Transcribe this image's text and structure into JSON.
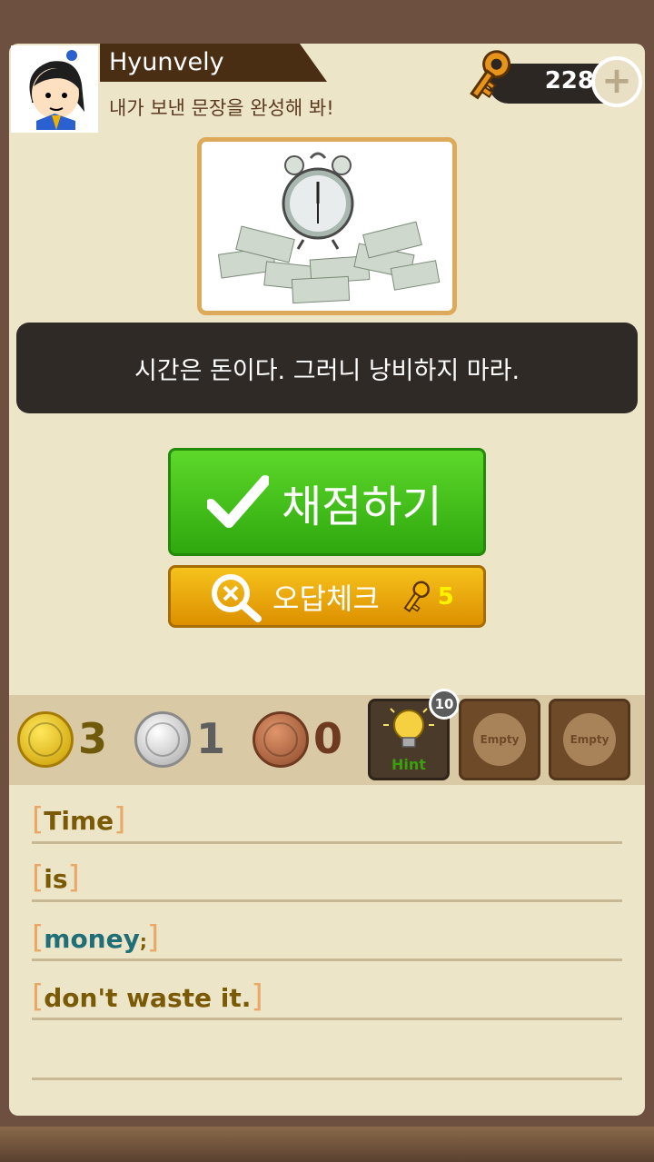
{
  "player": {
    "name": "Hyunvely",
    "message": "내가 보낸 문장을 완성해 봐!"
  },
  "keys": {
    "count": "228",
    "add_label": "+"
  },
  "sentence": "시간은 돈이다. 그러니 낭비하지 마라.",
  "buttons": {
    "grade_label": "채점하기",
    "check_label": "오답체크",
    "check_cost": "5"
  },
  "coins": {
    "gold": "3",
    "silver": "1",
    "bronze": "0"
  },
  "items": {
    "hint": {
      "label": "Hint",
      "badge": "10"
    },
    "slot2": "Empty",
    "slot3": "Empty"
  },
  "answer_words": [
    {
      "word": "Time",
      "suffix": ""
    },
    {
      "word": "is",
      "suffix": ""
    },
    {
      "word": "money",
      "suffix": ";"
    },
    {
      "word": "don't waste it",
      "suffix": "."
    }
  ],
  "colors": {
    "grade_green": "#2ea80e",
    "check_orange": "#dd9000",
    "panel_dark": "#302a26"
  }
}
